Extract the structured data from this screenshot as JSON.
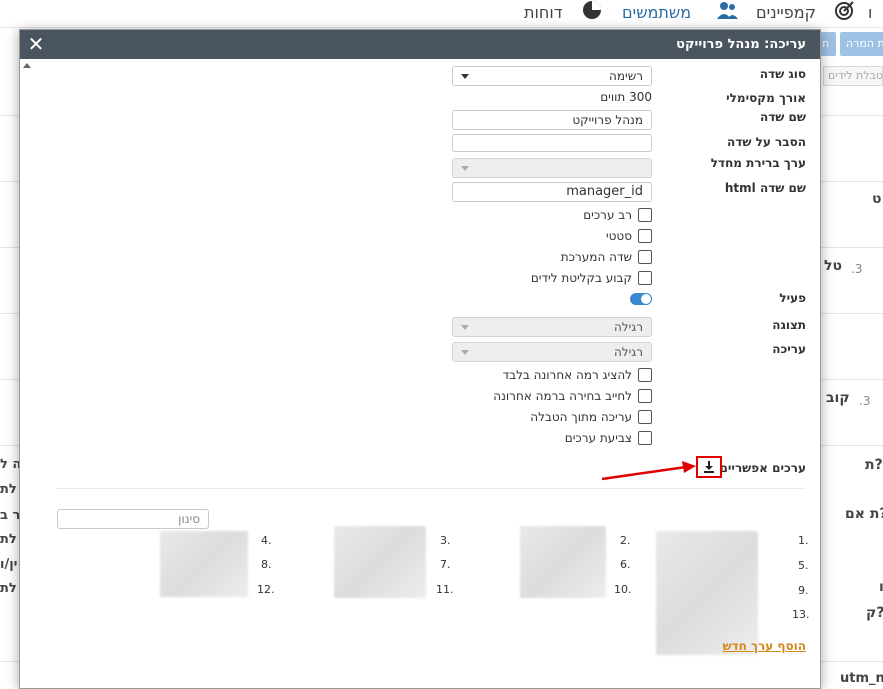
{
  "background": {
    "nav": {
      "reports_label": "דוחות",
      "users_label": "משתמשים",
      "campaigns_label": "קמפיינים",
      "fragment_label": "ו"
    },
    "buttons": {
      "target_label": "ת המרה",
      "small_label": "ת"
    },
    "leads_table_label": "טבלת לידים",
    "fragments": {
      "t1": "ט",
      "t2": "טל",
      "t3": "קוב",
      "t4": "ת?",
      "t5": "ת אם?",
      "t6": "ק?",
      "t7": "utm_n",
      "t8": "ו"
    },
    "numbers": {
      "n3a": ".3",
      "n3b": ".3"
    },
    "left_fragments": [
      "ה ל",
      "לת",
      "ר ב",
      "לת",
      "ין/ו",
      "לת"
    ]
  },
  "modal": {
    "title": "עריכה: מנהל פרוייקט",
    "close_icon": "close-icon",
    "fields": {
      "field_type_label": "סוג שדה",
      "field_type_value": "רשימה",
      "max_length_label": "אורך מקסימלי",
      "max_length_value": "300 תווים",
      "field_name_label": "שם שדה",
      "field_name_value": "מנהל פרוייקט",
      "field_desc_label": "הסבר על שדה",
      "field_desc_value": "",
      "default_label": "ערך ברירת מחדל",
      "default_value": "",
      "html_name_label": "שם שדה html",
      "html_name_value": "manager_id"
    },
    "checkboxes": {
      "multi_values": "רב ערכים",
      "static": "סטטי",
      "system_field": "שדה המערכת",
      "fixed_lead_intake": "קבוע בקליטת לידים"
    },
    "active": {
      "label": "פעיל",
      "on": true
    },
    "display": {
      "label": "תצוגה",
      "value": "רגילה"
    },
    "edit": {
      "label": "עריכה",
      "value": "רגילה"
    },
    "checkboxes2": {
      "last_level_only": "להציג רמה אחרונה בלבד",
      "require_last_level": "לחייב בחירה ברמה אחרונה",
      "edit_from_table": "עריכה מתוך הטבלה",
      "color_values": "צביעת ערכים"
    },
    "possible_values_label": "ערכים אפשריים:",
    "download_icon": "download-icon",
    "filter_placeholder": "סינון",
    "option_numbers": [
      ".1",
      ".2",
      ".3",
      ".4",
      ".5",
      ".6",
      ".7",
      ".8",
      ".9",
      ".10",
      ".11",
      ".12",
      ".13"
    ],
    "add_value_label": "הוסף ערך חדש"
  },
  "colors": {
    "header_bg": "#4b5560",
    "annotation_red": "#e00000",
    "link_orange": "#d4891a",
    "toggle_blue": "#3a86d0"
  }
}
